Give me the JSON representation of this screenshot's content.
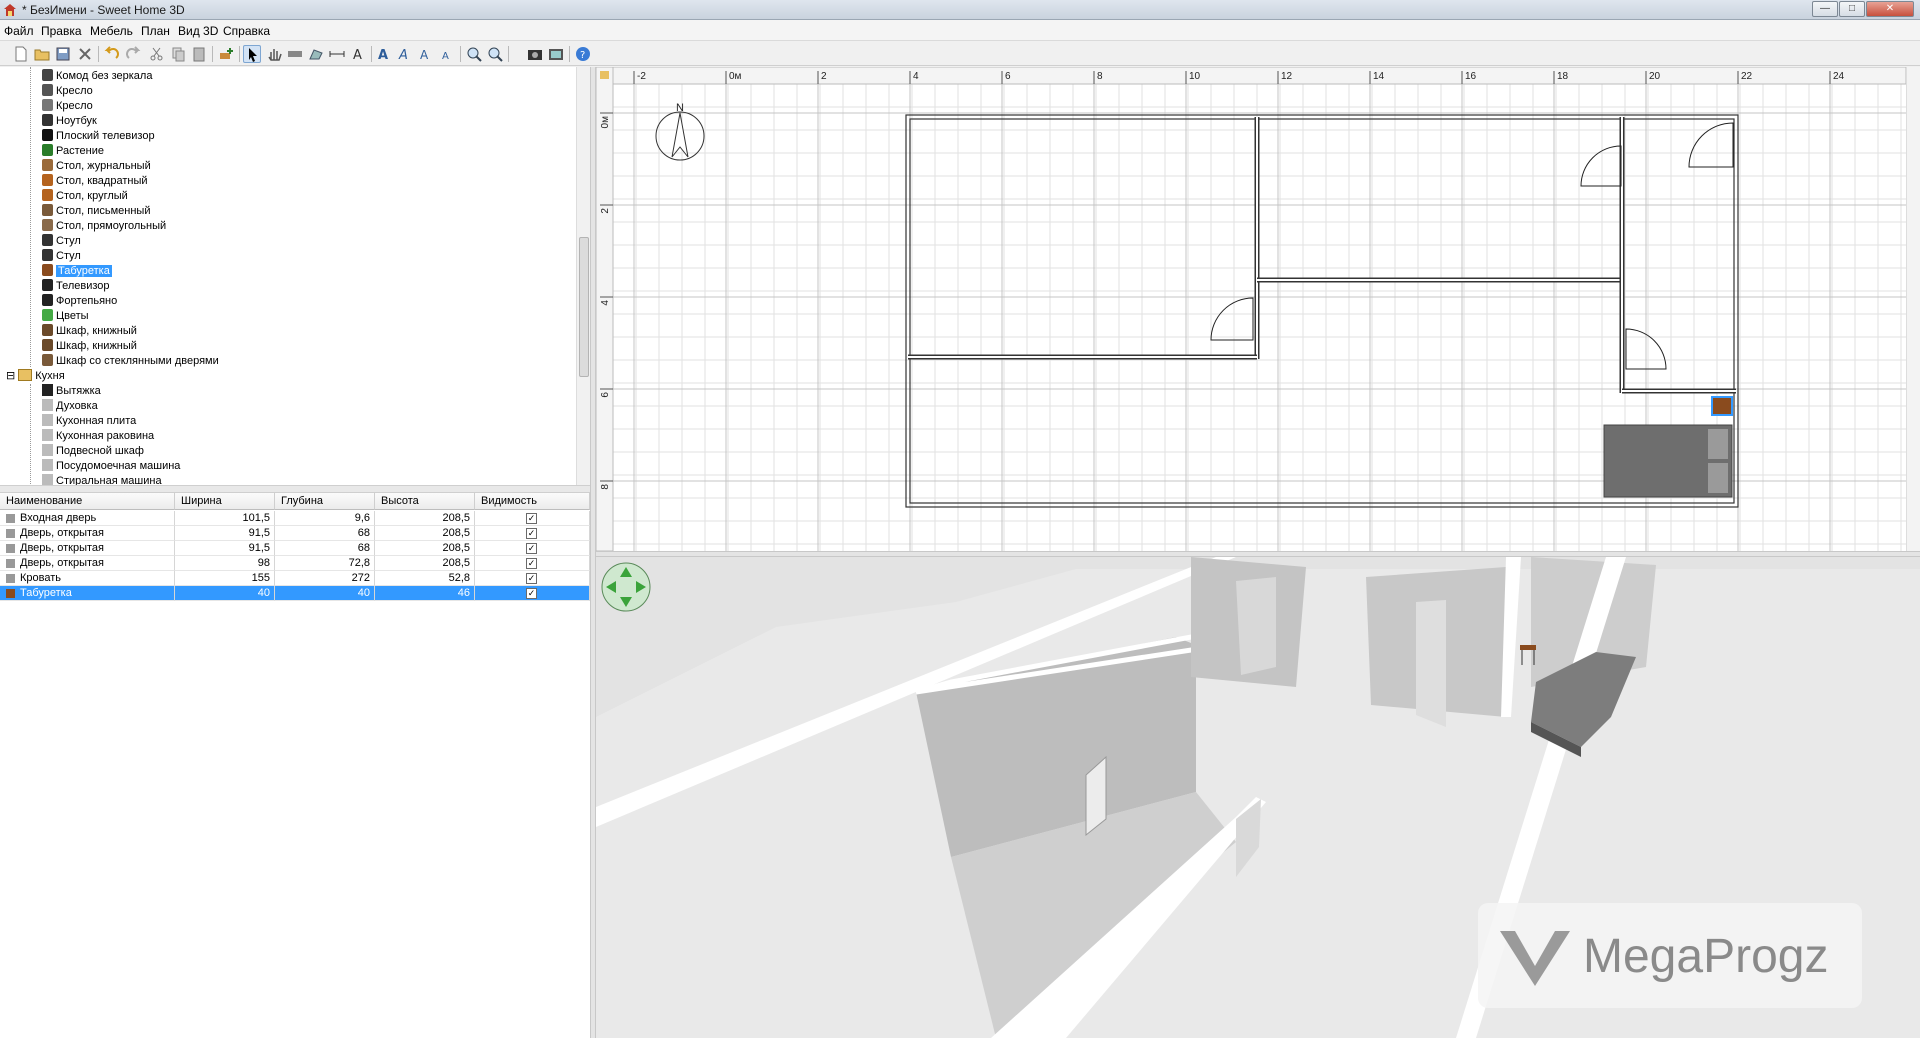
{
  "window": {
    "title": "* БезИмени - Sweet Home 3D",
    "minimize_label": "—",
    "maximize_label": "□",
    "close_label": "✕"
  },
  "menu": [
    "Файл",
    "Правка",
    "Мебель",
    "План",
    "Вид 3D",
    "Справка"
  ],
  "toolbar": {
    "icons": [
      "new-file-icon",
      "open-icon",
      "save-icon",
      "cut-tool-icon",
      "undo-icon",
      "redo-icon",
      "cut-icon",
      "copy-icon",
      "paste-icon",
      "add-furniture-icon",
      "select-icon",
      "pan-icon",
      "create-walls-icon",
      "create-rooms-icon",
      "create-dimensions-icon",
      "add-text-icon",
      "text-style-icon",
      "increase-text-icon",
      "decrease-text-icon",
      "zoom-in-icon",
      "zoom-out-icon",
      "photo-icon",
      "video-icon",
      "help-icon"
    ],
    "active": "select-icon"
  },
  "catalog": {
    "items": [
      {
        "label": "Комод без зеркала",
        "icon": "dresser-icon"
      },
      {
        "label": "Кресло",
        "icon": "armchair-icon"
      },
      {
        "label": "Кресло",
        "icon": "armchair-icon"
      },
      {
        "label": "Ноутбук",
        "icon": "laptop-icon"
      },
      {
        "label": "Плоский телевизор",
        "icon": "flat-tv-icon"
      },
      {
        "label": "Растение",
        "icon": "plant-icon"
      },
      {
        "label": "Стол, журнальный",
        "icon": "coffee-table-icon"
      },
      {
        "label": "Стол, квадратный",
        "icon": "square-table-icon"
      },
      {
        "label": "Стол, круглый",
        "icon": "round-table-icon"
      },
      {
        "label": "Стол, письменный",
        "icon": "desk-icon"
      },
      {
        "label": "Стол, прямоугольный",
        "icon": "rect-table-icon"
      },
      {
        "label": "Стул",
        "icon": "chair-icon"
      },
      {
        "label": "Стул",
        "icon": "chair-icon"
      },
      {
        "label": "Табуретка",
        "icon": "stool-icon",
        "selected": true
      },
      {
        "label": "Телевизор",
        "icon": "tv-icon"
      },
      {
        "label": "Фортепьяно",
        "icon": "piano-icon"
      },
      {
        "label": "Цветы",
        "icon": "flowers-icon"
      },
      {
        "label": "Шкаф, книжный",
        "icon": "bookcase-icon"
      },
      {
        "label": "Шкаф, книжный",
        "icon": "bookcase-icon"
      },
      {
        "label": "Шкаф со стеклянными дверями",
        "icon": "glass-cabinet-icon"
      }
    ],
    "category": {
      "label": "Кухня",
      "icon": "folder-icon"
    },
    "kitchen_items": [
      {
        "label": "Вытяжка",
        "icon": "hood-icon"
      },
      {
        "label": "Духовка",
        "icon": "oven-icon"
      },
      {
        "label": "Кухонная плита",
        "icon": "stove-icon"
      },
      {
        "label": "Кухонная раковина",
        "icon": "sink-icon"
      },
      {
        "label": "Подвесной шкаф",
        "icon": "wall-cabinet-icon"
      },
      {
        "label": "Посудомоечная машина",
        "icon": "dishwasher-icon"
      },
      {
        "label": "Стиральная машина",
        "icon": "washing-machine-icon"
      }
    ]
  },
  "furniture_table": {
    "columns": [
      "Наименование",
      "Ширина",
      "Глубина",
      "Высота",
      "Видимость"
    ],
    "rows": [
      {
        "name": "Входная дверь",
        "width": "101,5",
        "depth": "9,6",
        "height": "208,5",
        "visible": true
      },
      {
        "name": "Дверь, открытая",
        "width": "91,5",
        "depth": "68",
        "height": "208,5",
        "visible": true
      },
      {
        "name": "Дверь, открытая",
        "width": "91,5",
        "depth": "68",
        "height": "208,5",
        "visible": true
      },
      {
        "name": "Дверь, открытая",
        "width": "98",
        "depth": "72,8",
        "height": "208,5",
        "visible": true
      },
      {
        "name": "Кровать",
        "width": "155",
        "depth": "272",
        "height": "52,8",
        "visible": true
      },
      {
        "name": "Табуретка",
        "width": "40",
        "depth": "40",
        "height": "46",
        "visible": true,
        "selected": true
      }
    ]
  },
  "plan": {
    "ruler_x": [
      "-2",
      "0м",
      "2",
      "4",
      "6",
      "8",
      "10",
      "12",
      "14",
      "16",
      "18",
      "20",
      "22",
      "24"
    ],
    "ruler_y": [
      "0м",
      "2",
      "4",
      "6",
      "8"
    ],
    "compass_label": "N"
  },
  "watermark": {
    "text": "MegaProgz"
  },
  "colors": {
    "selection": "#3399ff",
    "wall": "#444444",
    "bed": "#6e6e6e",
    "stool": "#8a4b1e"
  }
}
